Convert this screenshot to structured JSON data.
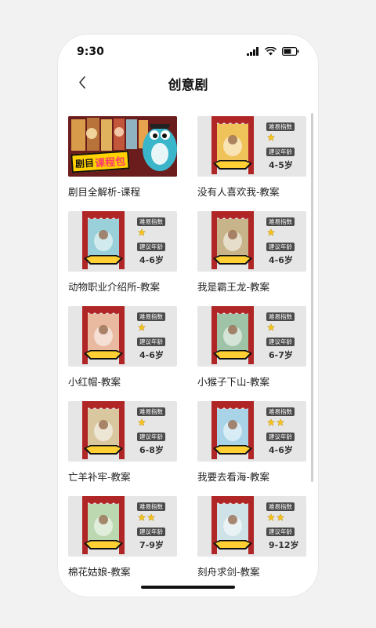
{
  "status_bar": {
    "time": "9:30"
  },
  "nav": {
    "title": "创意剧"
  },
  "course_card": {
    "title": "剧目全解析-课程",
    "banner_text_a": "剧目",
    "banner_text_b": "课程包"
  },
  "lesson_cards": [
    {
      "title": "没有人喜欢我-教案",
      "poster_label": "没有人喜欢我",
      "difficulty_label": "难易指数",
      "age_label": "建议年龄",
      "stars": 1,
      "age": "4-5岁",
      "poster_color": "#f0c25a"
    },
    {
      "title": "动物职业介绍所-教案",
      "poster_label": "动物职业介绍所",
      "difficulty_label": "难易指数",
      "age_label": "建议年龄",
      "stars": 1,
      "age": "4-6岁",
      "poster_color": "#9ad0d9"
    },
    {
      "title": "我是霸王龙-教案",
      "poster_label": "我是霸王龙",
      "difficulty_label": "难易指数",
      "age_label": "建议年龄",
      "stars": 1,
      "age": "4-6岁",
      "poster_color": "#c7b48a"
    },
    {
      "title": "小红帽-教案",
      "poster_label": "小红帽",
      "difficulty_label": "难易指数",
      "age_label": "建议年龄",
      "stars": 1,
      "age": "4-6岁",
      "poster_color": "#e9b9a0"
    },
    {
      "title": "小猴子下山-教案",
      "poster_label": "小猴子下山",
      "difficulty_label": "难易指数",
      "age_label": "建议年龄",
      "stars": 1,
      "age": "6-7岁",
      "poster_color": "#9fc3a6"
    },
    {
      "title": "亡羊补牢-教案",
      "poster_label": "亡羊补牢",
      "difficulty_label": "难易指数",
      "age_label": "建议年龄",
      "stars": 1,
      "age": "6-8岁",
      "poster_color": "#d9c7a0"
    },
    {
      "title": "我要去看海-教案",
      "poster_label": "我要去看海",
      "difficulty_label": "难易指数",
      "age_label": "建议年龄",
      "stars": 2,
      "age": "4-6岁",
      "poster_color": "#a9d4e8"
    },
    {
      "title": "棉花姑娘-教案",
      "poster_label": "棉花姑娘",
      "difficulty_label": "难易指数",
      "age_label": "建议年龄",
      "stars": 2,
      "age": "7-9岁",
      "poster_color": "#bcd8b0"
    },
    {
      "title": "刻舟求剑-教案",
      "poster_label": "刻舟求剑",
      "difficulty_label": "难易指数",
      "age_label": "建议年龄",
      "stars": 2,
      "age": "9-12岁",
      "poster_color": "#cfe2e8"
    }
  ],
  "colors": {
    "curtain": "#b02525",
    "ribbon": "#ffcf33",
    "star": "#f6c21c",
    "tag_bg": "#4a4a4a"
  }
}
